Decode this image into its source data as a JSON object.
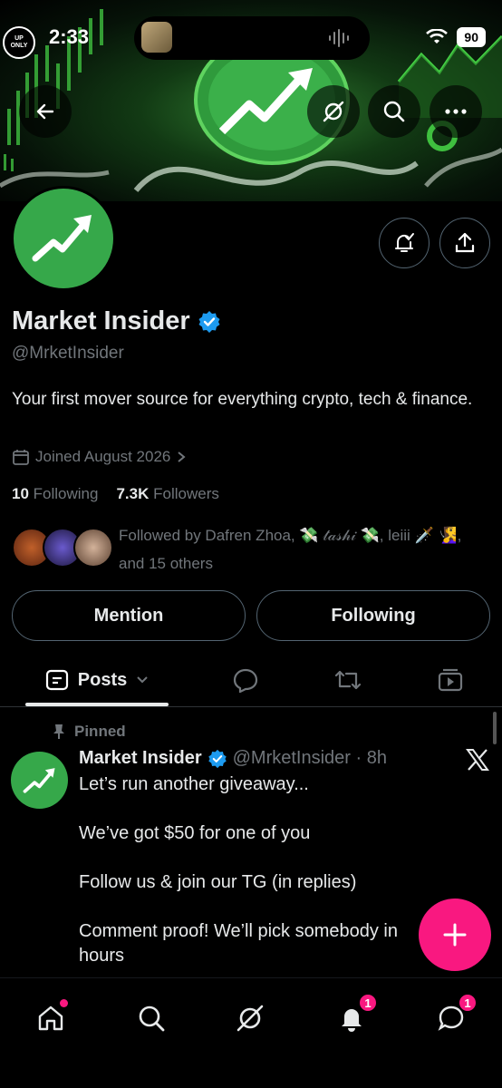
{
  "status_bar": {
    "time": "2:33",
    "battery": "90",
    "up_only_line1": "UP",
    "up_only_line2": "ONLY"
  },
  "header": {
    "back_icon": "arrow-left-icon",
    "grok_icon": "grok-icon",
    "search_icon": "search-icon",
    "more_icon": "more-icon"
  },
  "profile": {
    "name": "Market Insider",
    "handle": "@MrketInsider",
    "bio": "Your first mover source for everything crypto, tech & finance.",
    "joined": "Joined August 2026",
    "following_count": "10",
    "following_label": "Following",
    "followers_count": "7.3K",
    "followers_label": "Followers",
    "followed_by": "Followed by Dafren Zhoa, 💸 𝓉𝒶𝓈𝒽𝒾 💸, leiii 🗡️ 🧏‍♀️, and 15 others",
    "mention_label": "Mention",
    "following_button_label": "Following",
    "verified_color": "#1d9bf0",
    "avatar_color": "#36a84a"
  },
  "tabs": {
    "posts_label": "Posts",
    "items": [
      "posts",
      "replies",
      "reposts",
      "media"
    ]
  },
  "post": {
    "pinned_label": "Pinned",
    "author": "Market Insider",
    "handle_time": "@MrketInsider · 8h",
    "lines": [
      "Let’s run another giveaway...",
      "We’ve got $50 for one of you",
      "Follow us & join our TG (in replies)",
      "Comment proof! We’ll pick somebody in",
      "hours"
    ]
  },
  "bottom_nav": {
    "notifications_badge": "1",
    "messages_badge": "1",
    "accent": "#f91880"
  }
}
